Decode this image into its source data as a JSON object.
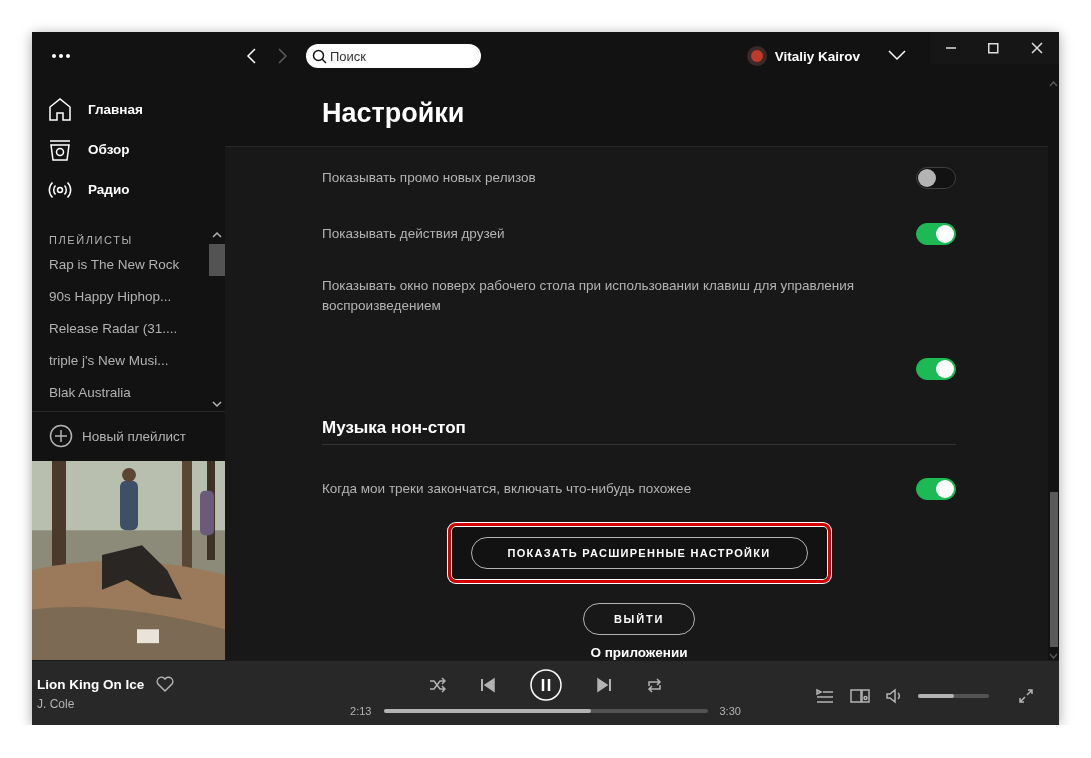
{
  "sidebar": {
    "nav": [
      {
        "kind": "home",
        "label": "Главная"
      },
      {
        "kind": "browse",
        "label": "Обзор"
      },
      {
        "kind": "radio",
        "label": "Радио"
      }
    ],
    "playlists_heading": "ПЛЕЙЛИСТЫ",
    "playlists": [
      "Rap is The New Rock",
      "90s Happy Hiphop...",
      "Release Radar (31....",
      "triple j's New Musi...",
      "Blak Australia"
    ],
    "new_playlist": "Новый плейлист"
  },
  "topbar": {
    "forward": {
      "disabled": true
    },
    "search": {
      "placeholder": "Поиск"
    },
    "user": "Vitaliy Kairov"
  },
  "page_title": "Настройки",
  "settings": [
    {
      "kind": "toggle",
      "label": "Показывать промо новых релизов",
      "on": false
    },
    {
      "kind": "toggle",
      "label": "Показывать действия друзей",
      "on": true
    },
    {
      "kind": "toggle_below",
      "label": "Показывать окно поверх рабочего стола при использовании клавиш для управления воспроизведением",
      "on": true
    },
    {
      "kind": "heading",
      "label": "Музыка нон-стоп"
    },
    {
      "kind": "toggle",
      "label": "Когда мои треки закончатся, включать что-нибудь похожее",
      "on": true
    }
  ],
  "advanced_button": {
    "label": "ПОКАЗАТЬ РАСШИРЕННЫЕ НАСТРОЙКИ",
    "highlighted": true
  },
  "logout_button": "ВЫЙТИ",
  "about_link": "О приложении",
  "player": {
    "title": "Lion King On Ice",
    "artist": "J. Cole",
    "liked": false,
    "playing": true,
    "elapsed": "2:13",
    "duration": "3:30",
    "progress": {
      "level": 0.64
    },
    "volume": {
      "level": 0.5
    }
  }
}
